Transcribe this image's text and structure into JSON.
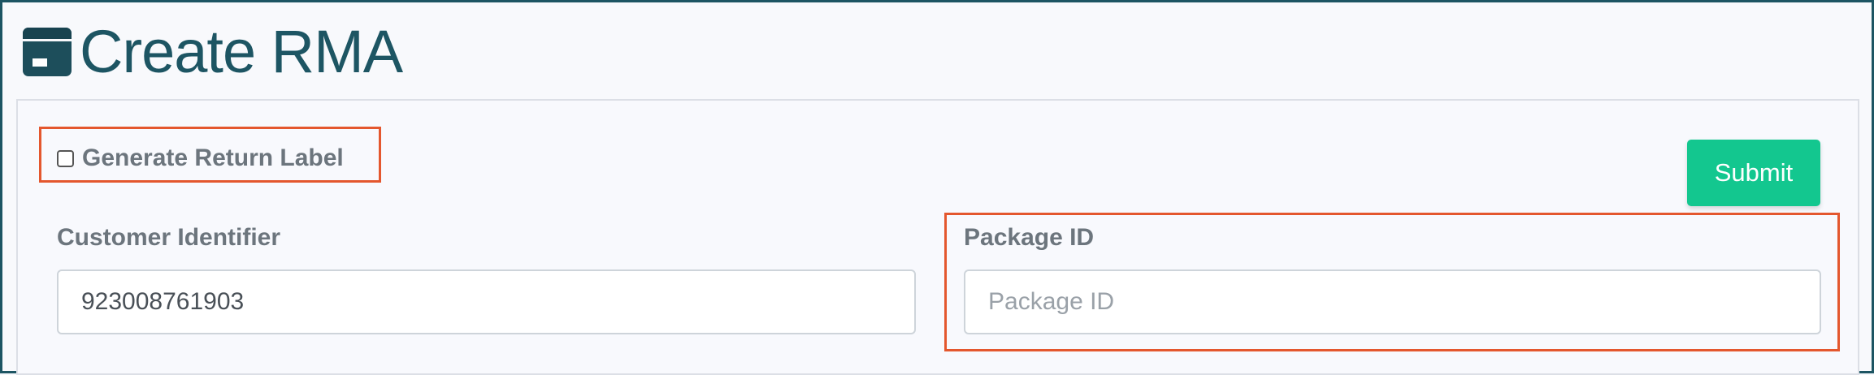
{
  "header": {
    "title": "Create RMA",
    "icon": "archive-box-icon"
  },
  "form": {
    "generate_return_label": {
      "label": "Generate Return Label",
      "checked": false
    },
    "submit_label": "Submit",
    "customer_identifier": {
      "label": "Customer Identifier",
      "value": "923008761903"
    },
    "package_id": {
      "label": "Package ID",
      "value": "",
      "placeholder": "Package ID"
    }
  },
  "colors": {
    "brand": "#1d5563",
    "submit": "#13c78f",
    "highlight": "#e4572e"
  }
}
